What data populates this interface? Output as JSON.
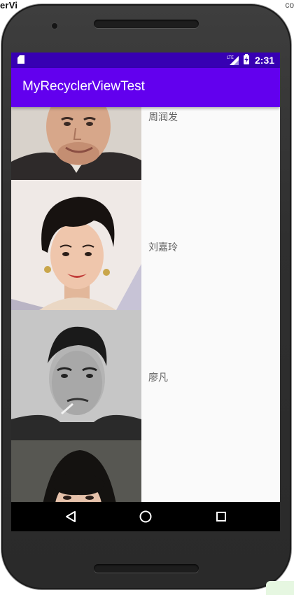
{
  "ide": {
    "left_fragment": "erVi",
    "right_fragment": "co"
  },
  "status_bar": {
    "time": "2:31",
    "network": "LTE",
    "color": "#3700b3"
  },
  "app_bar": {
    "title": "MyRecyclerViewTest",
    "color": "#6200ee"
  },
  "list": {
    "items": [
      {
        "name": "周润发",
        "photo": "portrait-photo"
      },
      {
        "name": "刘嘉玲",
        "photo": "portrait-photo"
      },
      {
        "name": "廖凡",
        "photo": "portrait-photo"
      },
      {
        "name": "",
        "photo": "portrait-photo"
      }
    ]
  },
  "nav_bar": {
    "buttons": [
      "back-icon",
      "home-icon",
      "recents-icon"
    ]
  }
}
